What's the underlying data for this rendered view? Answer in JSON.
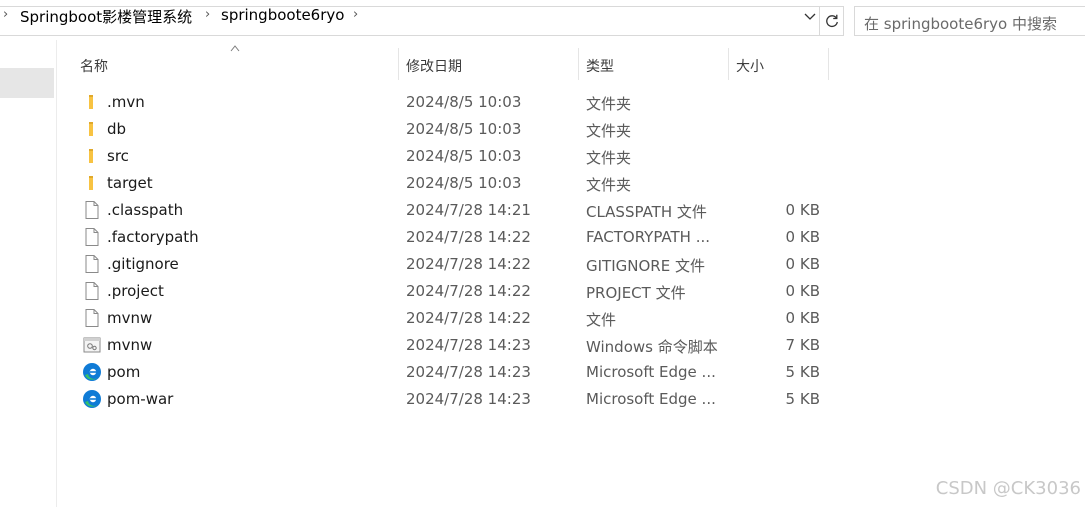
{
  "address": {
    "crumbs": [
      "Springboot影楼管理系统",
      "springboote6ryo"
    ]
  },
  "search": {
    "placeholder": "在 springboote6ryo 中搜索"
  },
  "columns": {
    "name": "名称",
    "modified": "修改日期",
    "type": "类型",
    "size": "大小"
  },
  "files": [
    {
      "name": ".mvn",
      "date": "2024/8/5 10:03",
      "type": "文件夹",
      "size": "",
      "icon": "folder-icon"
    },
    {
      "name": "db",
      "date": "2024/8/5 10:03",
      "type": "文件夹",
      "size": "",
      "icon": "folder-icon"
    },
    {
      "name": "src",
      "date": "2024/8/5 10:03",
      "type": "文件夹",
      "size": "",
      "icon": "folder-icon"
    },
    {
      "name": "target",
      "date": "2024/8/5 10:03",
      "type": "文件夹",
      "size": "",
      "icon": "folder-icon"
    },
    {
      "name": ".classpath",
      "date": "2024/7/28 14:21",
      "type": "CLASSPATH 文件",
      "size": "0 KB",
      "icon": "file-icon"
    },
    {
      "name": ".factorypath",
      "date": "2024/7/28 14:22",
      "type": "FACTORYPATH ...",
      "size": "0 KB",
      "icon": "file-icon"
    },
    {
      "name": ".gitignore",
      "date": "2024/7/28 14:22",
      "type": "GITIGNORE 文件",
      "size": "0 KB",
      "icon": "file-icon"
    },
    {
      "name": ".project",
      "date": "2024/7/28 14:22",
      "type": "PROJECT 文件",
      "size": "0 KB",
      "icon": "file-icon"
    },
    {
      "name": "mvnw",
      "date": "2024/7/28 14:22",
      "type": "文件",
      "size": "0 KB",
      "icon": "file-icon"
    },
    {
      "name": "mvnw",
      "date": "2024/7/28 14:23",
      "type": "Windows 命令脚本",
      "size": "7 KB",
      "icon": "script-icon"
    },
    {
      "name": "pom",
      "date": "2024/7/28 14:23",
      "type": "Microsoft Edge ...",
      "size": "5 KB",
      "icon": "edge-icon"
    },
    {
      "name": "pom-war",
      "date": "2024/7/28 14:23",
      "type": "Microsoft Edge ...",
      "size": "5 KB",
      "icon": "edge-icon"
    }
  ],
  "watermark": "CSDN @CK3036",
  "colors": {
    "folder": "#f8c342",
    "selection": "#e6e6e6",
    "edge_blue": "#0f7bd6",
    "edge_green": "#35c26b"
  }
}
